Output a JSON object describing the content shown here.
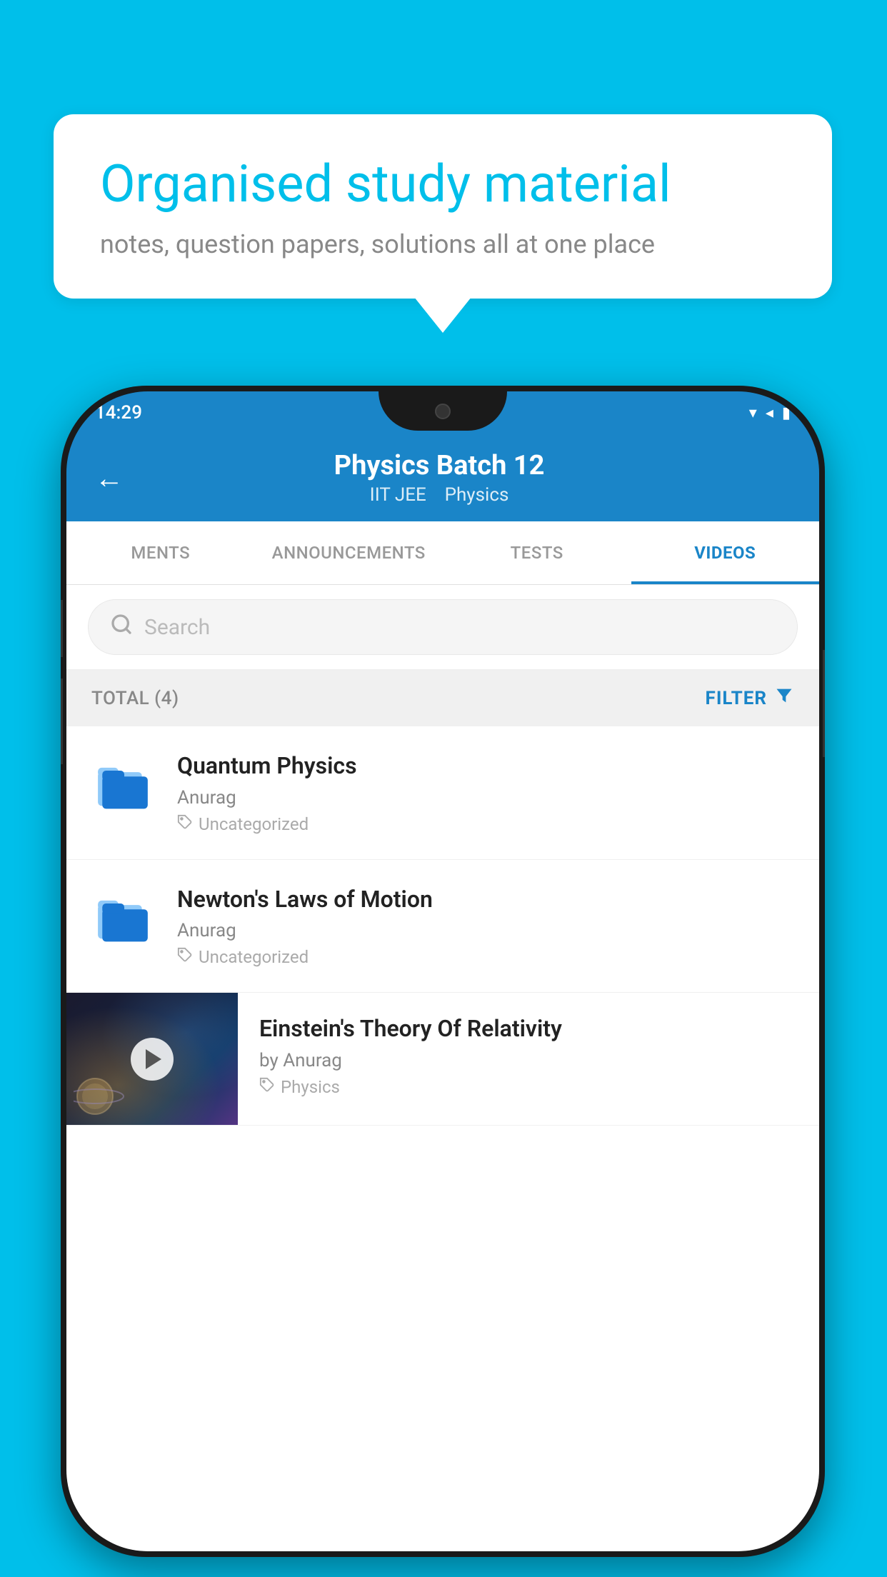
{
  "bubble": {
    "title": "Organised study material",
    "subtitle": "notes, question papers, solutions all at one place"
  },
  "status_bar": {
    "time": "14:29",
    "wifi": "▼",
    "signal": "◀",
    "battery": "▮"
  },
  "header": {
    "title": "Physics Batch 12",
    "subtitle_part1": "IIT JEE",
    "subtitle_part2": "Physics",
    "back_label": "←"
  },
  "tabs": [
    {
      "label": "MENTS",
      "active": false
    },
    {
      "label": "ANNOUNCEMENTS",
      "active": false
    },
    {
      "label": "TESTS",
      "active": false
    },
    {
      "label": "VIDEOS",
      "active": true
    }
  ],
  "search": {
    "placeholder": "Search"
  },
  "filter_bar": {
    "total_label": "TOTAL (4)",
    "filter_label": "FILTER"
  },
  "videos": [
    {
      "id": 1,
      "title": "Quantum Physics",
      "author": "Anurag",
      "tag": "Uncategorized",
      "type": "folder"
    },
    {
      "id": 2,
      "title": "Newton's Laws of Motion",
      "author": "Anurag",
      "tag": "Uncategorized",
      "type": "folder"
    },
    {
      "id": 3,
      "title": "Einstein's Theory Of Relativity",
      "author": "by Anurag",
      "tag": "Physics",
      "type": "video"
    }
  ],
  "colors": {
    "brand_blue": "#1a85c8",
    "background_cyan": "#00BFEA",
    "text_primary": "#222222",
    "text_secondary": "#888888",
    "text_muted": "#aaaaaa"
  }
}
